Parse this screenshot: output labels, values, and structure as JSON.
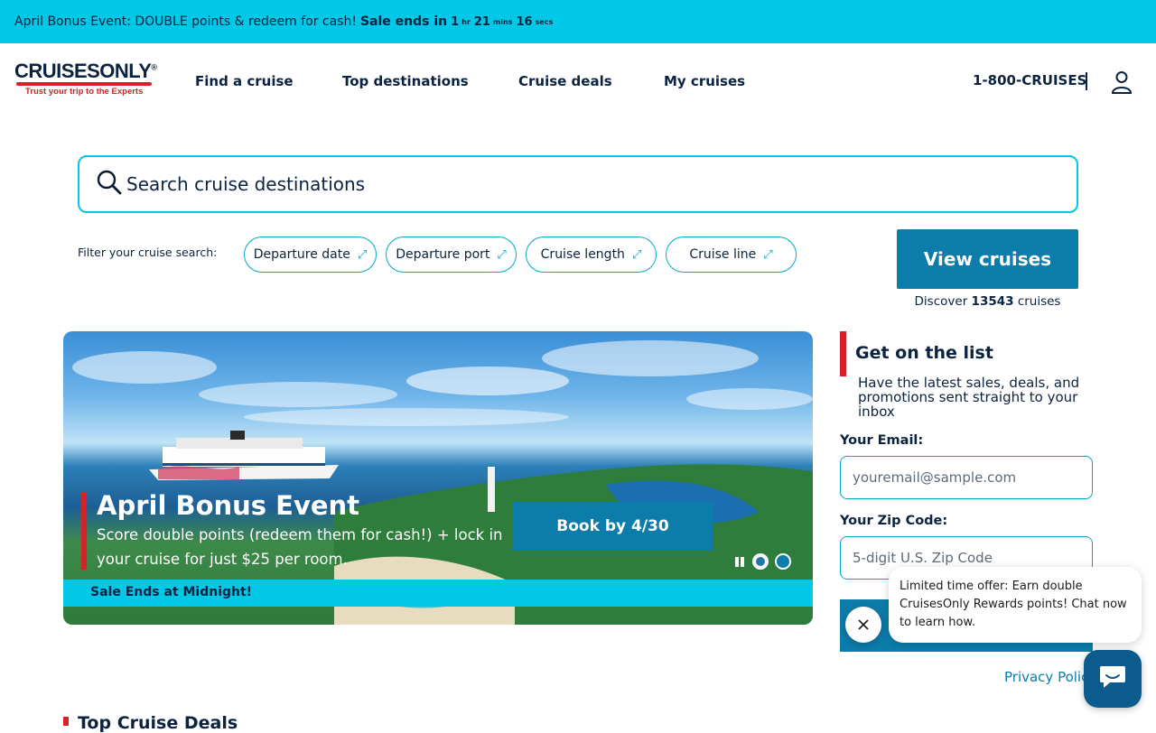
{
  "promo": {
    "text": "April Bonus Event: DOUBLE points & redeem for cash!",
    "sale_ends": "Sale ends in",
    "hours": "1",
    "hours_unit": "hr",
    "minutes": "21",
    "minutes_unit": "mins",
    "seconds": "16",
    "seconds_unit": "secs"
  },
  "header": {
    "logo_text": "CRUISESONLY",
    "logo_mark": "®",
    "logo_tagline": "Trust your trip to the Experts",
    "nav": [
      "Find a cruise",
      "Top destinations",
      "Cruise deals",
      "My cruises"
    ],
    "phone": "1-800-CRUISES",
    "account_icon": "user-icon"
  },
  "search": {
    "placeholder": "Search cruise destinations",
    "icon": "search-icon"
  },
  "filters": {
    "label": "Filter your cruise search:",
    "chips": [
      "Departure date",
      "Departure port",
      "Cruise length",
      "Cruise line"
    ],
    "chip_icon": "expand-arrows-icon"
  },
  "cta": {
    "view_label": "View cruises",
    "discover_prefix": "Discover",
    "count": "13543",
    "discover_suffix": "cruises"
  },
  "hero": {
    "title": "April Bonus Event",
    "subtitle": "Score double points (redeem them for cash!) + lock in your cruise for just $25 per room.",
    "book_label": "Book by 4/30",
    "sale_text": "Sale Ends at Midnight!",
    "slide_count": 2,
    "active_slide": 1
  },
  "signup": {
    "title": "Get on the list",
    "description": "Have the latest sales, deals, and promotions sent straight to your inbox",
    "email_label": "Your Email:",
    "email_placeholder": "youremail@sample.com",
    "zip_label": "Your Zip Code:",
    "zip_placeholder": "5-digit U.S. Zip Code",
    "privacy": "Privacy Policy"
  },
  "chat": {
    "message": "Limited time offer: Earn double CruisesOnly Rewards points! Chat now to learn how.",
    "close_icon": "close-icon",
    "launcher_icon": "chat-icon"
  },
  "section": {
    "title": "Top Cruise Deals"
  },
  "colors": {
    "accent": "#00c8e6",
    "primary": "#0c7cab",
    "brand_red": "#d62128",
    "navy": "#0b2340"
  }
}
